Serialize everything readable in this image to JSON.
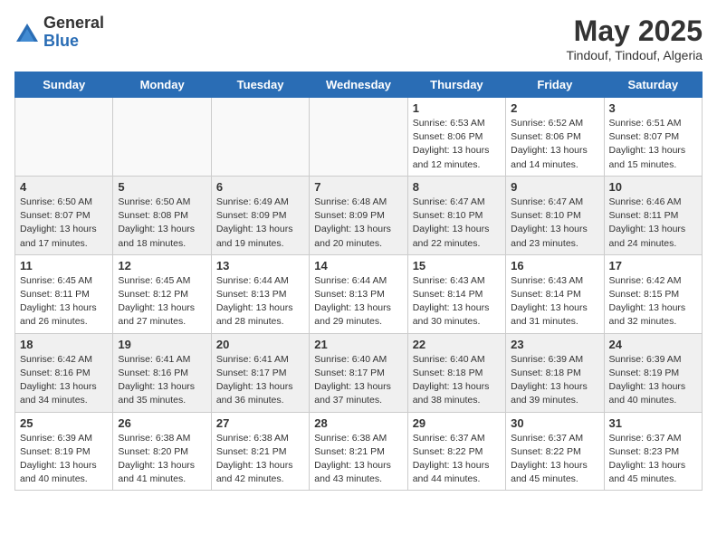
{
  "header": {
    "logo_general": "General",
    "logo_blue": "Blue",
    "title": "May 2025",
    "subtitle": "Tindouf, Tindouf, Algeria"
  },
  "weekdays": [
    "Sunday",
    "Monday",
    "Tuesday",
    "Wednesday",
    "Thursday",
    "Friday",
    "Saturday"
  ],
  "weeks": [
    [
      {
        "day": "",
        "info": ""
      },
      {
        "day": "",
        "info": ""
      },
      {
        "day": "",
        "info": ""
      },
      {
        "day": "",
        "info": ""
      },
      {
        "day": "1",
        "info": "Sunrise: 6:53 AM\nSunset: 8:06 PM\nDaylight: 13 hours and 12 minutes."
      },
      {
        "day": "2",
        "info": "Sunrise: 6:52 AM\nSunset: 8:06 PM\nDaylight: 13 hours and 14 minutes."
      },
      {
        "day": "3",
        "info": "Sunrise: 6:51 AM\nSunset: 8:07 PM\nDaylight: 13 hours and 15 minutes."
      }
    ],
    [
      {
        "day": "4",
        "info": "Sunrise: 6:50 AM\nSunset: 8:07 PM\nDaylight: 13 hours and 17 minutes."
      },
      {
        "day": "5",
        "info": "Sunrise: 6:50 AM\nSunset: 8:08 PM\nDaylight: 13 hours and 18 minutes."
      },
      {
        "day": "6",
        "info": "Sunrise: 6:49 AM\nSunset: 8:09 PM\nDaylight: 13 hours and 19 minutes."
      },
      {
        "day": "7",
        "info": "Sunrise: 6:48 AM\nSunset: 8:09 PM\nDaylight: 13 hours and 20 minutes."
      },
      {
        "day": "8",
        "info": "Sunrise: 6:47 AM\nSunset: 8:10 PM\nDaylight: 13 hours and 22 minutes."
      },
      {
        "day": "9",
        "info": "Sunrise: 6:47 AM\nSunset: 8:10 PM\nDaylight: 13 hours and 23 minutes."
      },
      {
        "day": "10",
        "info": "Sunrise: 6:46 AM\nSunset: 8:11 PM\nDaylight: 13 hours and 24 minutes."
      }
    ],
    [
      {
        "day": "11",
        "info": "Sunrise: 6:45 AM\nSunset: 8:11 PM\nDaylight: 13 hours and 26 minutes."
      },
      {
        "day": "12",
        "info": "Sunrise: 6:45 AM\nSunset: 8:12 PM\nDaylight: 13 hours and 27 minutes."
      },
      {
        "day": "13",
        "info": "Sunrise: 6:44 AM\nSunset: 8:13 PM\nDaylight: 13 hours and 28 minutes."
      },
      {
        "day": "14",
        "info": "Sunrise: 6:44 AM\nSunset: 8:13 PM\nDaylight: 13 hours and 29 minutes."
      },
      {
        "day": "15",
        "info": "Sunrise: 6:43 AM\nSunset: 8:14 PM\nDaylight: 13 hours and 30 minutes."
      },
      {
        "day": "16",
        "info": "Sunrise: 6:43 AM\nSunset: 8:14 PM\nDaylight: 13 hours and 31 minutes."
      },
      {
        "day": "17",
        "info": "Sunrise: 6:42 AM\nSunset: 8:15 PM\nDaylight: 13 hours and 32 minutes."
      }
    ],
    [
      {
        "day": "18",
        "info": "Sunrise: 6:42 AM\nSunset: 8:16 PM\nDaylight: 13 hours and 34 minutes."
      },
      {
        "day": "19",
        "info": "Sunrise: 6:41 AM\nSunset: 8:16 PM\nDaylight: 13 hours and 35 minutes."
      },
      {
        "day": "20",
        "info": "Sunrise: 6:41 AM\nSunset: 8:17 PM\nDaylight: 13 hours and 36 minutes."
      },
      {
        "day": "21",
        "info": "Sunrise: 6:40 AM\nSunset: 8:17 PM\nDaylight: 13 hours and 37 minutes."
      },
      {
        "day": "22",
        "info": "Sunrise: 6:40 AM\nSunset: 8:18 PM\nDaylight: 13 hours and 38 minutes."
      },
      {
        "day": "23",
        "info": "Sunrise: 6:39 AM\nSunset: 8:18 PM\nDaylight: 13 hours and 39 minutes."
      },
      {
        "day": "24",
        "info": "Sunrise: 6:39 AM\nSunset: 8:19 PM\nDaylight: 13 hours and 40 minutes."
      }
    ],
    [
      {
        "day": "25",
        "info": "Sunrise: 6:39 AM\nSunset: 8:19 PM\nDaylight: 13 hours and 40 minutes."
      },
      {
        "day": "26",
        "info": "Sunrise: 6:38 AM\nSunset: 8:20 PM\nDaylight: 13 hours and 41 minutes."
      },
      {
        "day": "27",
        "info": "Sunrise: 6:38 AM\nSunset: 8:21 PM\nDaylight: 13 hours and 42 minutes."
      },
      {
        "day": "28",
        "info": "Sunrise: 6:38 AM\nSunset: 8:21 PM\nDaylight: 13 hours and 43 minutes."
      },
      {
        "day": "29",
        "info": "Sunrise: 6:37 AM\nSunset: 8:22 PM\nDaylight: 13 hours and 44 minutes."
      },
      {
        "day": "30",
        "info": "Sunrise: 6:37 AM\nSunset: 8:22 PM\nDaylight: 13 hours and 45 minutes."
      },
      {
        "day": "31",
        "info": "Sunrise: 6:37 AM\nSunset: 8:23 PM\nDaylight: 13 hours and 45 minutes."
      }
    ]
  ]
}
